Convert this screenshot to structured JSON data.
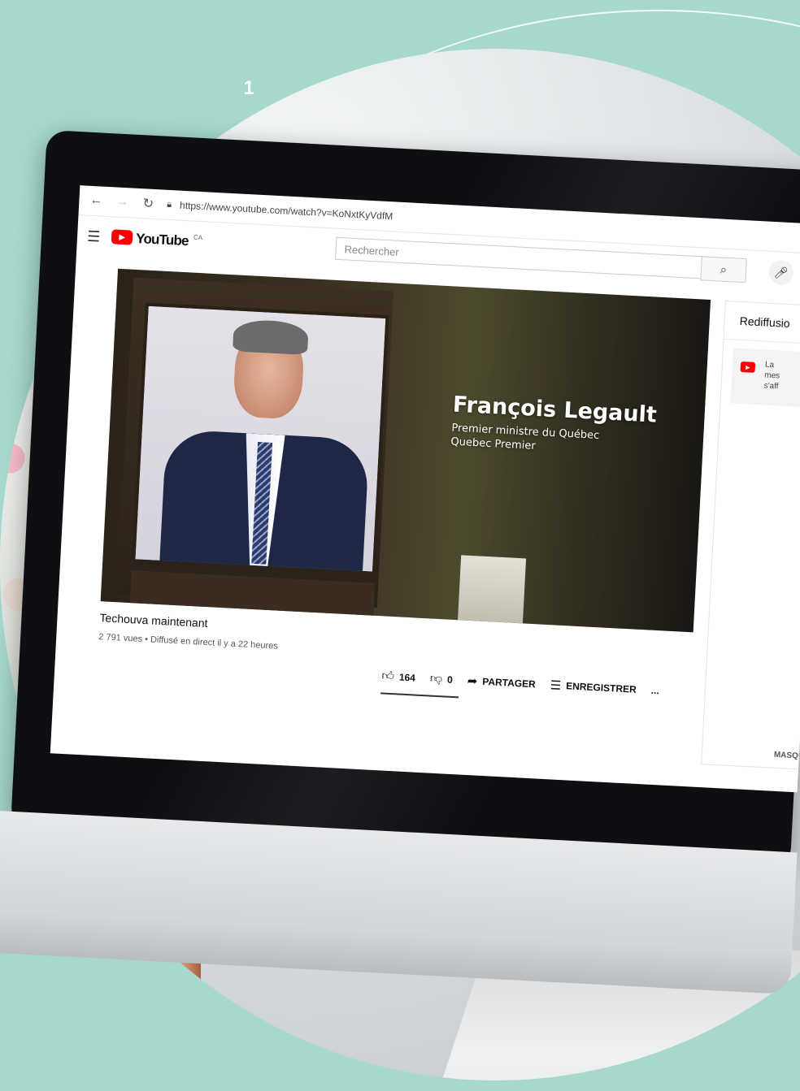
{
  "step_number": "1",
  "browser": {
    "url": "https://www.youtube.com/watch?v=KoNxtKyVdfM"
  },
  "youtube": {
    "logo_text": "YouTube",
    "country_code": "CA",
    "search": {
      "placeholder": "Rechercher"
    }
  },
  "video": {
    "overlay": {
      "name": "François Legault",
      "subtitle_line1": "Premier ministre du Québec",
      "subtitle_line2": "Quebec Premier"
    },
    "title": "Techouva maintenant",
    "meta": "2 791 vues • Diffusé en direct il y a 22 heures",
    "actions": {
      "likes": "164",
      "dislikes": "0",
      "share_label": "PARTAGER",
      "save_label": "ENREGISTRER",
      "more_label": "..."
    }
  },
  "side_panel": {
    "title": "Rediffusio",
    "message_lines": [
      "La",
      "mes",
      "s'aff"
    ],
    "hide_label": "MASQU"
  }
}
